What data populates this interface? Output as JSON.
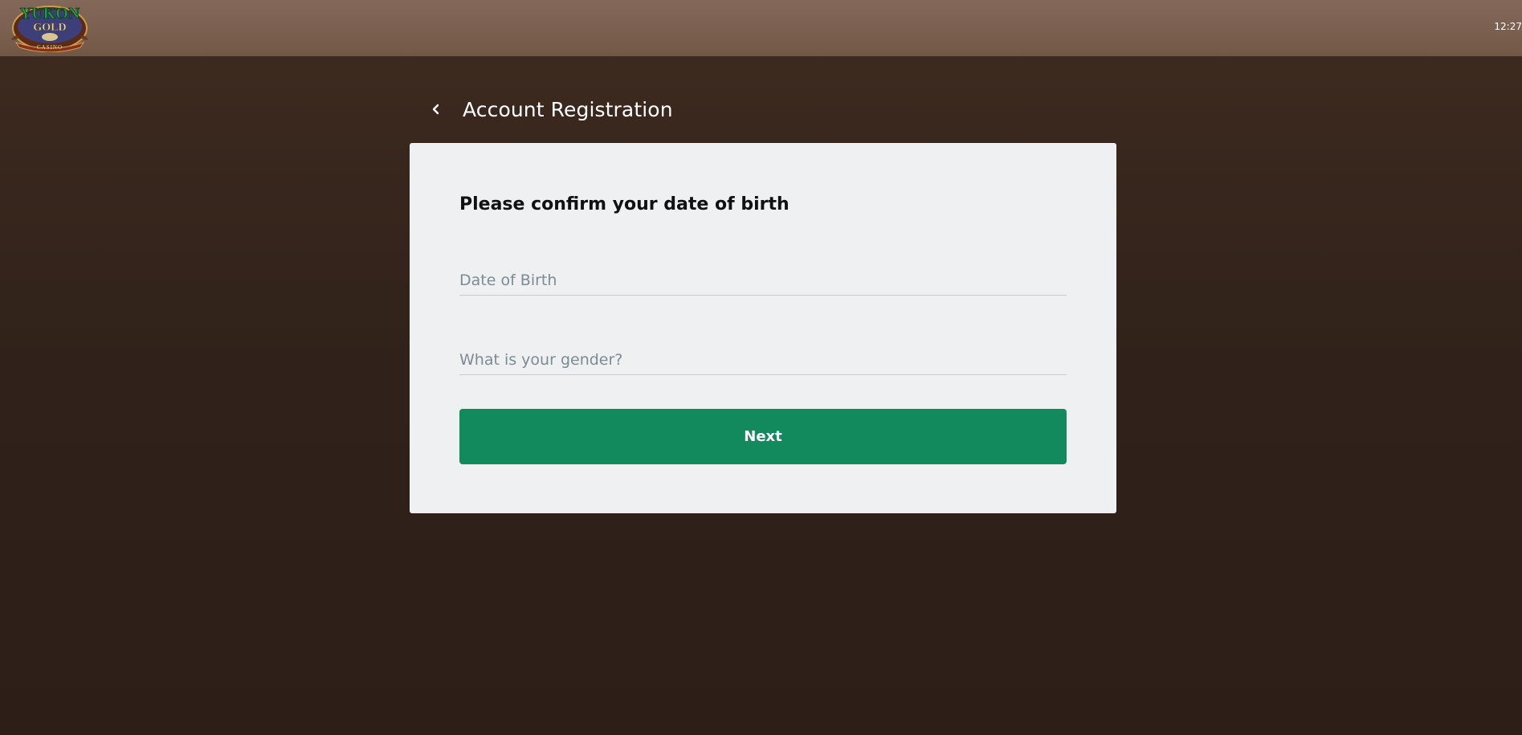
{
  "header": {
    "logo": {
      "icon": "yukon-gold-casino-logo",
      "text_top": "YUKON",
      "text_middle": "GOLD",
      "text_bottom": "CASINO"
    },
    "clock": "12:27"
  },
  "page": {
    "back_icon": "chevron-left-icon",
    "title": "Account Registration"
  },
  "form": {
    "heading": "Please confirm your date of birth",
    "fields": [
      {
        "label": "Date of Birth",
        "value": ""
      },
      {
        "label": "What is your gender?",
        "value": ""
      }
    ],
    "next_label": "Next"
  },
  "colors": {
    "topbar": "#7b6050",
    "background": "#3a281e",
    "card": "#eef0f2",
    "primary_button": "#128a5d",
    "field_label": "#7d8b93"
  }
}
